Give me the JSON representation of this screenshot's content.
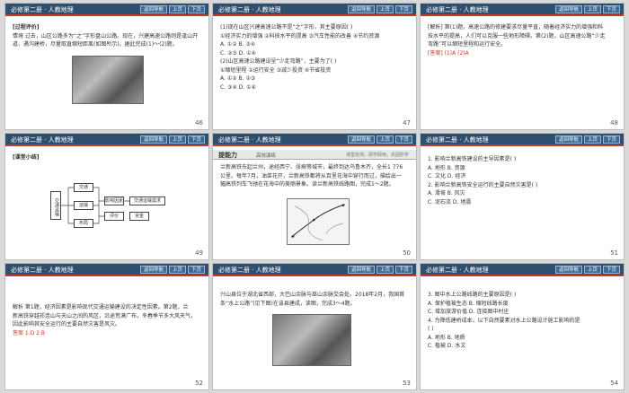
{
  "header": {
    "title": "必修第二册 · 人教地理",
    "nav": [
      "返回导航",
      "上页",
      "下页"
    ]
  },
  "slides": [
    {
      "page": "46",
      "lines": [
        "[过程评价]",
        "情境  过去，山区公路多为“之”字形盘山公路。现在，兴建高速公路则是逢山开",
        "道、遇沟建桥，尽量取直缩短距离(如图所示)。据此完成(1)～(2)题。"
      ]
    },
    {
      "page": "47",
      "lines": [
        "(1)现在山区兴建高速公路不是“之”字形，其主要原因(      )",
        "①经济实力的增强  ②科技水平的提高  ③汽车性能的改善  ④节约资源",
        "A. ①②              B. ③④",
        "C. ②③              D. ①④",
        "(2)山区高速公路建设呈“少走弯路”，主要为了(      )",
        "①缩短里程  ②运行安全  ③减少投资  ④节省投资",
        "A. ①②              B. ②③",
        "C. ③④              D. ①④"
      ]
    },
    {
      "page": "48",
      "lines": [
        "[解析]  第(1)题，高速公路的修建要求尽量平直，随着经济实力的增强和科",
        "技水平的提高，人们可以克服一些地形障碍。第(2)题，山区高速公路“少走",
        "弯路”可以缩短里程和运行安全。",
        "[答案]  (1)A    (2)A"
      ]
    },
    {
      "page": "49",
      "lines": [
        "[课堂小结]"
      ],
      "concept": {
        "root": "交通运输",
        "middle": [
          "交通",
          "运输",
          "布局"
        ],
        "right_top": "影响因素",
        "right_bottom": "评价",
        "far_right_top": "交通运输需求",
        "far_right_bottom": "资金"
      }
    },
    {
      "page": "50",
      "banner": {
        "title": "提能力",
        "subtitle": "高效演练",
        "tip": "课堂检测，即学即用，巩固所学"
      },
      "lines": [
        "兰新高铁东起兰州，途经西宁、张掖等城市，最终到达乌鲁木齐，全长1 776",
        "公里。每年7月，油菜花开，兰新高铁都将从百里花海中穿行而过，描绘出一",
        "幅高铁列车飞驰在花海中的美丽景象。读兰新高铁线路图，完成1～2题。"
      ]
    },
    {
      "page": "51",
      "lines": [
        "1. 影响兰新高铁建设的主导因素是(      )",
        "A. 地形            B. 资源",
        "C. 文化            D. 经济",
        "2. 影响兰新高铁安全运行的主要自然灾害是(      )",
        "A. 滑坡            B. 风灾",
        "C. 泥石流          D. 地震"
      ]
    },
    {
      "page": "52",
      "lines": [
        "解析  第1题，经济因素是影响现代交通运输建设的决定性因素。第2题，兰",
        "新高铁穿越祁连山与天山之间的风区，沿途荒漠广布，冬春季节多大风天气，",
        "因此影响其安全运行的主要自然灾害是风灾。",
        "答案  1.D    2.B"
      ]
    },
    {
      "page": "53",
      "lines": [
        "兴山县位于湖北省西部，大巴山余脉与巫山余脉交会处。2018年2月，我国首",
        "条“水上公路”(见下图)在该县建成，读图，完成3～4题。"
      ]
    },
    {
      "page": "54",
      "lines": [
        "3. 图中水上公路线路的主要原因是(      )",
        "A. 保护植被生态            B. 缩短线路长度",
        "C. 增加旅游价值            D. 连接图中村庄",
        "4. 为降低建桥成本，以下自然要素对水上公路设计施工影响的是",
        "(      )",
        "A. 地形                    B. 地质",
        "C. 植被                    D. 水文"
      ]
    }
  ]
}
